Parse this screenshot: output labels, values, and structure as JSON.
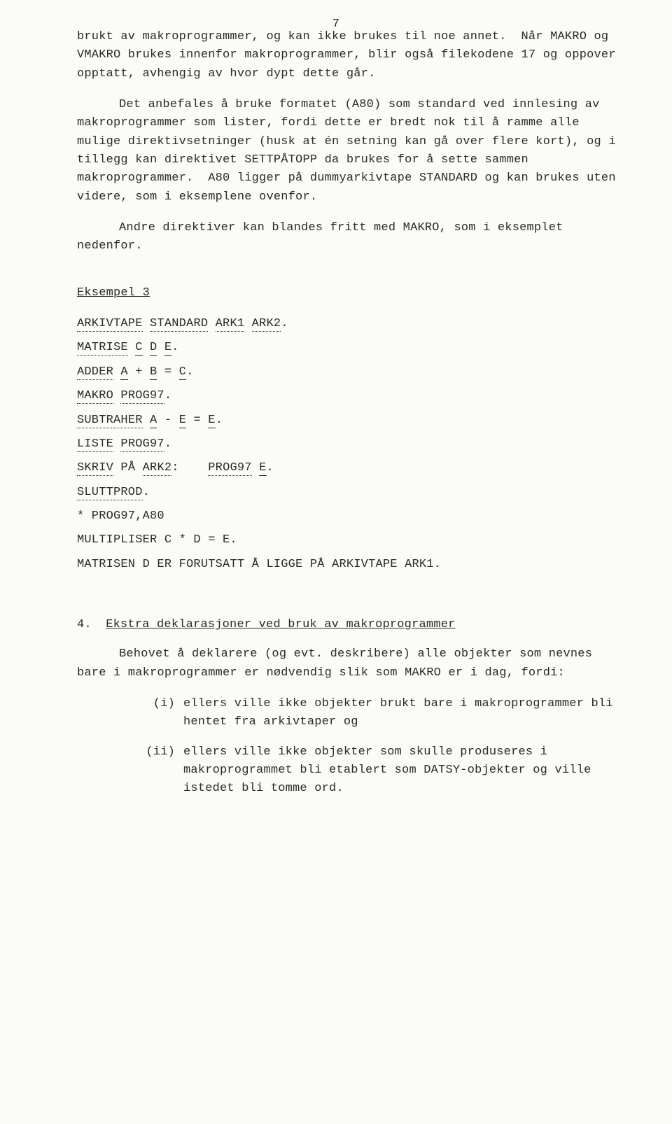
{
  "page_number": "7",
  "paragraphs": {
    "p1": "brukt av makroprogrammer, og kan ikke brukes til noe annet.  Når MAKRO og VMAKRO brukes innenfor makroprogrammer, blir også filekodene 17 og oppover opptatt, avhengig av hvor dypt dette går.",
    "p2": "Det anbefales å bruke formatet (A80) som standard ved innlesing av makroprogrammer som lister, fordi dette er bredt nok til å ramme alle mulige direktivsetninger (husk at én setning kan gå over flere kort), og i tillegg kan direktivet SETTPÅTOPP da brukes for å sette sammen makroprogrammer.  A80 ligger på dummyarkivtape STANDARD og kan brukes uten videre, som i eksemplene ovenfor.",
    "p3": "Andre direktiver kan blandes fritt med MAKRO, som i eksemplet nedenfor."
  },
  "example": {
    "heading": "Eksempel 3",
    "lines": {
      "l1a": "ARKIVTAPE",
      "l1b": "STANDARD",
      "l1c": "ARK1",
      "l1d": "ARK2",
      "l2a": "MATRISE",
      "l2b": "C",
      "l2c": "D",
      "l2d": "E",
      "l3a": "ADDER",
      "l3b": "A",
      "l3c": "+",
      "l3d": "B",
      "l3e": "=",
      "l3f": "C",
      "l4a": "MAKRO",
      "l4b": "PROG97",
      "l5a": "SUBTRAHER",
      "l5b": "A",
      "l5c": "-",
      "l5d": "E",
      "l5e": "=",
      "l5f": "E",
      "l6a": "LISTE",
      "l6b": "PROG97",
      "l7a": "SKRIV",
      "l7b": "PÅ",
      "l7c": "ARK2",
      "l7d": ":",
      "l7e": "PROG97",
      "l7f": "E",
      "l8a": "SLUTTPROD",
      "l9": "* PROG97,A80",
      "l10": "MULTIPLISER C * D = E.",
      "l11": "MATRISEN D ER FORUTSATT Å LIGGE PÅ ARKIVTAPE ARK1."
    }
  },
  "section4": {
    "num": "4.",
    "title": "Ekstra deklarasjoner ved bruk av makroprogrammer",
    "intro": "Behovet å deklarere (og evt. deskribere) alle objekter som nevnes bare i makroprogrammer er nødvendig slik som MAKRO er i dag, fordi:",
    "items": {
      "i1_marker": "(i)",
      "i1_text": "ellers ville ikke objekter brukt bare i makroprogrammer bli hentet fra arkivtaper og",
      "i2_marker": "(ii)",
      "i2_text": "ellers ville ikke objekter som skulle produseres i makroprogrammet bli etablert som DATSY-objekter og ville istedet bli tomme ord."
    }
  }
}
